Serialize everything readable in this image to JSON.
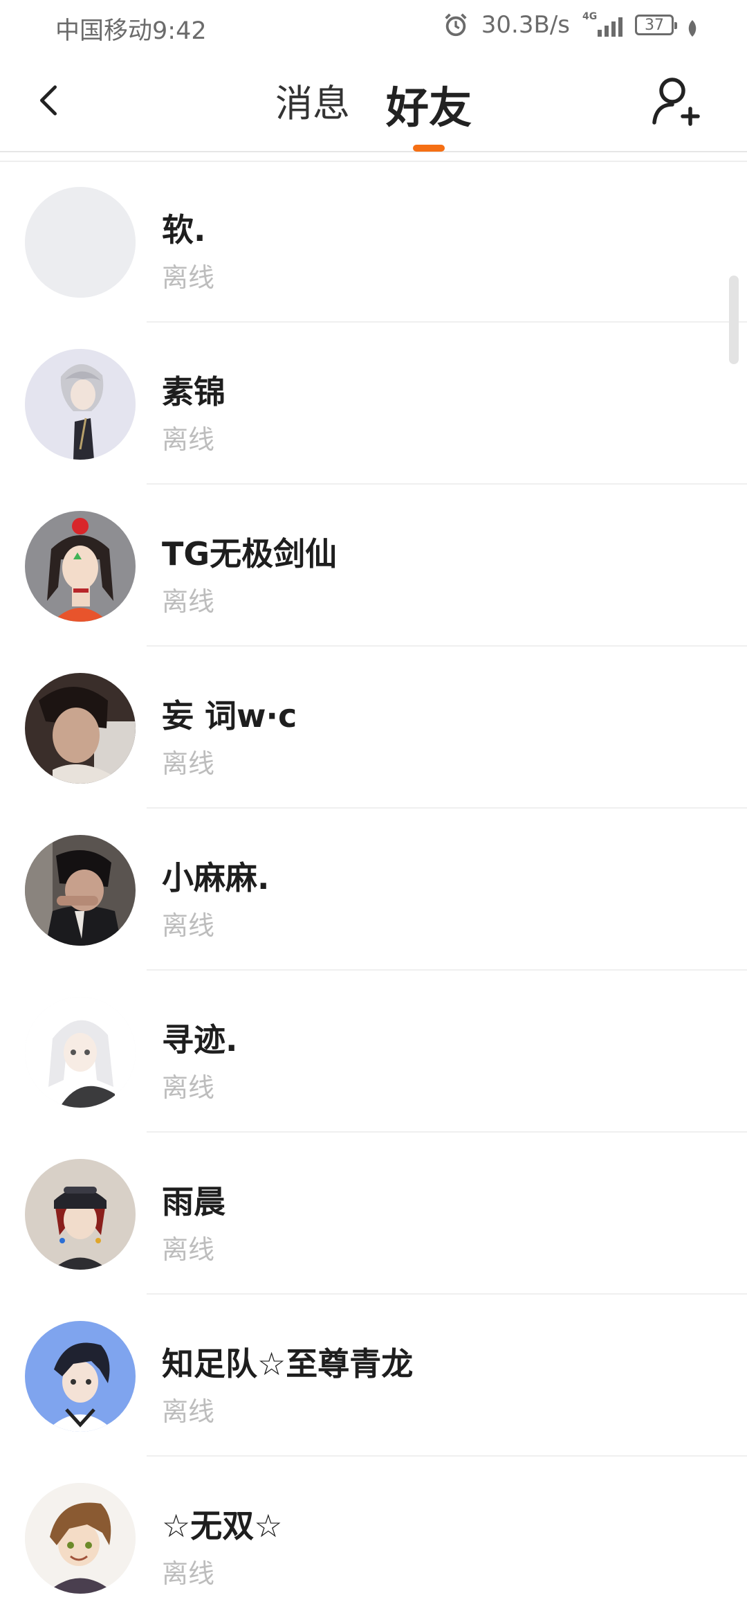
{
  "status_bar": {
    "carrier": "中国移动",
    "time": "9:42",
    "net_speed": "30.3B/s",
    "network_type": "4G",
    "battery": "37"
  },
  "header": {
    "tabs": [
      {
        "label": "消息",
        "active": false
      },
      {
        "label": "好友",
        "active": true
      }
    ],
    "accent_color": "#f56f14"
  },
  "friends": [
    {
      "name": "软.",
      "status": "离线",
      "avatar": "blank"
    },
    {
      "name": "素锦",
      "status": "离线",
      "avatar": "anime-white-hair"
    },
    {
      "name": "TG无极剑仙",
      "status": "离线",
      "avatar": "anime-red-hat"
    },
    {
      "name": "妄 词w·c",
      "status": "离线",
      "avatar": "photo-boy"
    },
    {
      "name": "小麻麻.",
      "status": "离线",
      "avatar": "photo-boy-dark"
    },
    {
      "name": "寻迹.",
      "status": "离线",
      "avatar": "anime-white-girl"
    },
    {
      "name": "雨晨",
      "status": "离线",
      "avatar": "anime-cap-red-hair"
    },
    {
      "name": "知足队☆至尊青龙",
      "status": "离线",
      "avatar": "anime-blue-bg"
    },
    {
      "name": "☆无双☆",
      "status": "离线",
      "avatar": "anime-brown-hair"
    }
  ]
}
